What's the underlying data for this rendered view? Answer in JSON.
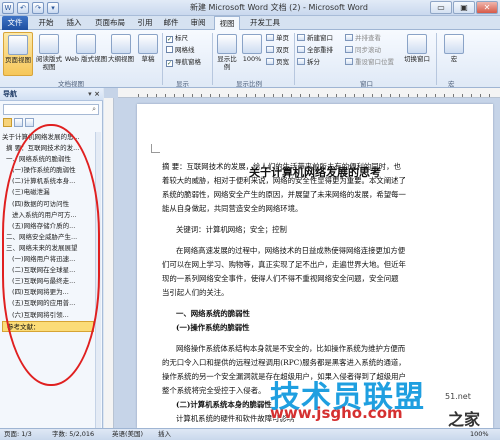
{
  "window": {
    "title": "新建 Microsoft Word 文档 (2) - Microsoft Word"
  },
  "qat": [
    "W",
    "↶",
    "↷",
    "▾"
  ],
  "window_controls": [
    "▭",
    "▣",
    "✕"
  ],
  "tabs": [
    "文件",
    "开始",
    "插入",
    "页面布局",
    "引用",
    "邮件",
    "审阅",
    "视图",
    "开发工具"
  ],
  "ribbon": {
    "views": [
      "页面视图",
      "阅读版式视图",
      "Web 版式视图",
      "大纲视图",
      "草稿"
    ],
    "show": [
      "标尺",
      "网格线",
      "导航窗格"
    ],
    "zoom_label": "显示比例",
    "zoom_value": "100%",
    "page_views": [
      "单页",
      "双页",
      "页宽"
    ],
    "window_items": [
      "新建窗口",
      "全部重排",
      "拆分"
    ],
    "window_items2": [
      "并排查看",
      "同步滚动",
      "重设窗口位置"
    ],
    "switch_window": "切换窗口",
    "macro": "宏",
    "group_labels": [
      "文档视图",
      "显示",
      "显示比例",
      "窗口",
      "宏"
    ]
  },
  "nav": {
    "title": "导航",
    "close": "▾ ×",
    "items": [
      "关于计算机网络发展的思...",
      "摘 要：互联网技术的发...",
      "一、网络系统的脆弱性",
      "(一)操作系统的脆弱性",
      "(二)计算机系统本身...",
      "(三)电磁泄漏",
      "(四)数据的可访问性",
      "进入系统的用户可方...",
      "(五)网络存储介质的...",
      "二、网络安全威胁产生...",
      "三、网络未来的发展展望",
      "(一)网络用户将迅速...",
      "(二)互联网在全球星...",
      "(三)互联网与最终走...",
      "(四)互联网将更为...",
      "(五)互联网的应用普...",
      "(六)互联网将引领...",
      "参考文献："
    ],
    "selected_index": 17
  },
  "doc": {
    "title": "关于计算机网络发展的思考",
    "lines": [
      "摘  要：互联网技术的发展，给人们的生活带来前所未有的便利的同时，也",
      "着较大的威胁，相对于便利来说，网络的安全性显得更为重要。本文阐述了",
      "系统的脆弱性，网络安全产生的原因，并展望了未来网络的发展，希望每一",
      "能从自身做起，共同营造安全的网络环境。",
      "关键词：计算机网络；安全；控制",
      "在网络高速发展的过程中，网络技术的日益成熟使得网络连接更加方便",
      "们可以在网上学习、购物等，真正实现了足不出户，走遍世界大地。但近年",
      "现的一系列网络安全事件，使得人们不得不重视网络安全问题，安全问题",
      "当引起人们的关注。",
      "一、网络系统的脆弱性",
      "(一)操作系统的脆弱性",
      "网络操作系统体系结构本身就是不安全的，比如操作系统为维护方便而",
      "的无口令入口和提供的远程过程调用(RPC)服务都是黑客进入系统的通道，",
      "操作系统的另一个安全漏洞就是存在超级用户，如果入侵者得到了超级用户",
      "整个系统将完全受控于入侵者。",
      "(二)计算机系统本身的脆弱性",
      "计算机系统的硬件和软件故障可影响"
    ]
  },
  "watermark": {
    "main": "技术员联盟",
    "sub": "www.jsgho.com",
    "corner1": "51.net",
    "corner2": "之家"
  },
  "status": {
    "page": "页面: 1/3",
    "words": "字数: 5/2,016",
    "lang": "英语(美国)",
    "mode": "插入",
    "zoom": "100%"
  }
}
